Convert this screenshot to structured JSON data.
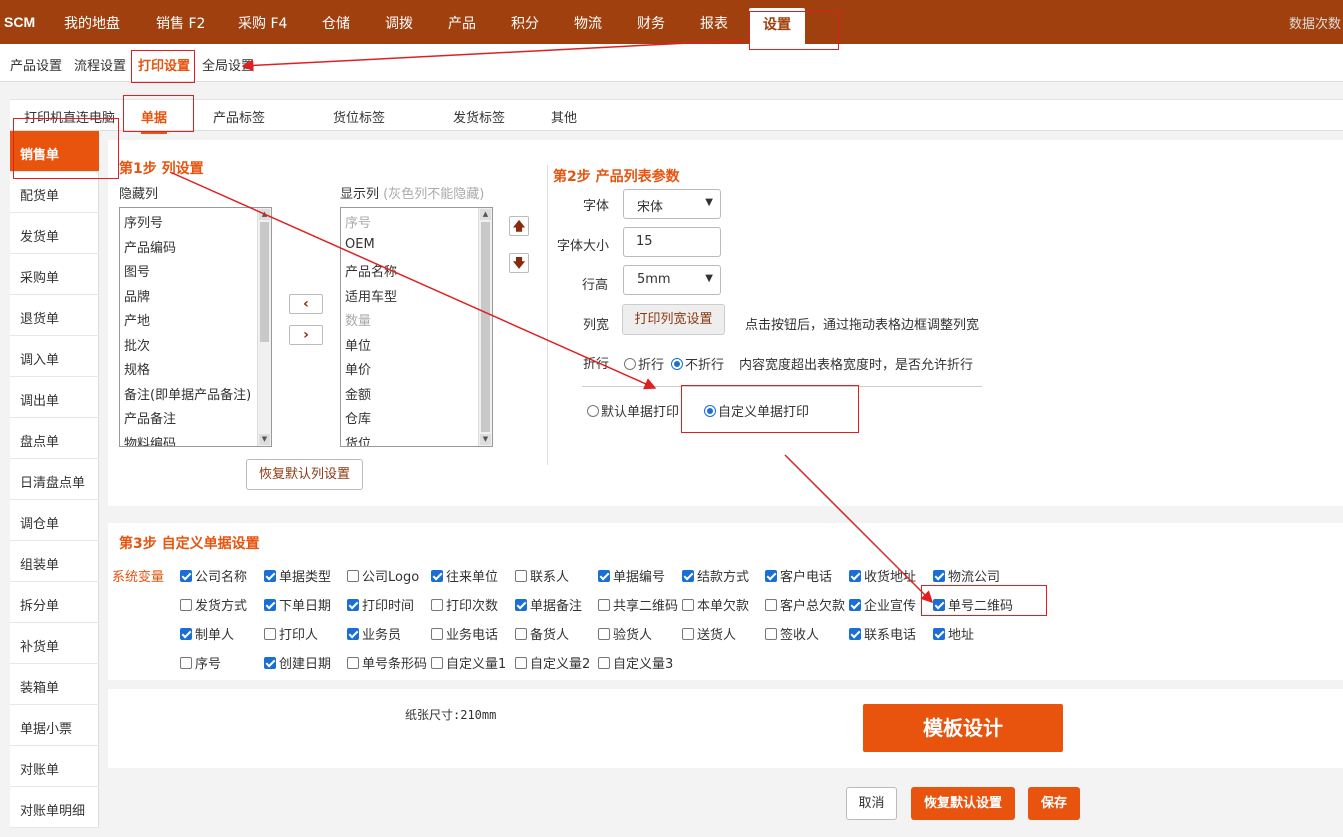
{
  "topbar": {
    "logo": "SCM",
    "nav": [
      "我的地盘",
      "销售 F2",
      "采购 F4",
      "仓储",
      "调拨",
      "产品",
      "积分",
      "物流",
      "财务",
      "报表",
      "设置"
    ],
    "right_text": "数据次数"
  },
  "subnav": [
    "产品设置",
    "流程设置",
    "打印设置",
    "全局设置"
  ],
  "tabs": [
    "打印机直连电脑",
    "单据",
    "产品标签",
    "货位标签",
    "发货标签",
    "其他"
  ],
  "sidebar": [
    "销售单",
    "配货单",
    "发货单",
    "采购单",
    "退货单",
    "调入单",
    "调出单",
    "盘点单",
    "日清盘点单",
    "调仓单",
    "组装单",
    "拆分单",
    "补货单",
    "装箱单",
    "单据小票",
    "对账单",
    "对账单明细"
  ],
  "step1": {
    "title": "第1步 列设置",
    "hidden_label": "隐藏列",
    "shown_label": "显示列",
    "shown_hint": "(灰色列不能隐藏)",
    "hidden_cols": [
      "序列号",
      "产品编码",
      "图号",
      "品牌",
      "产地",
      "批次",
      "规格",
      "备注(即单据产品备注)",
      "产品备注",
      "物料编码"
    ],
    "shown_cols": [
      "序号",
      "OEM",
      "产品名称",
      "适用车型",
      "数量",
      "单位",
      "单价",
      "金额",
      "仓库",
      "货位"
    ],
    "restore_btn": "恢复默认列设置"
  },
  "step2": {
    "title": "第2步 产品列表参数",
    "font_label": "字体",
    "font_value": "宋体",
    "fontsize_label": "字体大小",
    "fontsize_value": "15",
    "lineheight_label": "行高",
    "lineheight_value": "5mm",
    "colwidth_label": "列宽",
    "colwidth_btn": "打印列宽设置",
    "colwidth_hint": "点击按钮后，通过拖动表格边框调整列宽",
    "wrap_label": "折行",
    "wrap_yes": "折行",
    "wrap_no": "不折行",
    "wrap_hint": "内容宽度超出表格宽度时，是否允许折行",
    "print_default": "默认单据打印",
    "print_custom": "自定义单据打印"
  },
  "step3": {
    "title": "第3步 自定义单据设置",
    "sysvar_label": "系统变量",
    "rows": [
      [
        [
          "公司名称",
          true
        ],
        [
          "单据类型",
          true
        ],
        [
          "公司Logo",
          false
        ],
        [
          "往来单位",
          true
        ],
        [
          "联系人",
          false
        ],
        [
          "单据编号",
          true
        ],
        [
          "结款方式",
          true
        ],
        [
          "客户电话",
          true
        ],
        [
          "收货地址",
          true
        ],
        [
          "物流公司",
          true
        ]
      ],
      [
        [
          "发货方式",
          false
        ],
        [
          "下单日期",
          true
        ],
        [
          "打印时间",
          true
        ],
        [
          "打印次数",
          false
        ],
        [
          "单据备注",
          true
        ],
        [
          "共享二维码",
          false
        ],
        [
          "本单欠款",
          false
        ],
        [
          "客户总欠款",
          false
        ],
        [
          "企业宣传",
          true
        ],
        [
          "单号二维码",
          true
        ]
      ],
      [
        [
          "制单人",
          true
        ],
        [
          "打印人",
          false
        ],
        [
          "业务员",
          true
        ],
        [
          "业务电话",
          false
        ],
        [
          "备货人",
          false
        ],
        [
          "验货人",
          false
        ],
        [
          "送货人",
          false
        ],
        [
          "签收人",
          false
        ],
        [
          "联系电话",
          true
        ],
        [
          "地址",
          true
        ]
      ],
      [
        [
          "序号",
          false
        ],
        [
          "创建日期",
          true
        ],
        [
          "单号条形码",
          false
        ],
        [
          "自定义量1",
          false
        ],
        [
          "自定义量2",
          false
        ],
        [
          "自定义量3",
          false
        ]
      ]
    ]
  },
  "paper": {
    "label": "纸张尺寸:210mm"
  },
  "template_btn": "模板设计",
  "footer": {
    "cancel": "取消",
    "restore": "恢复默认设置",
    "save": "保存"
  },
  "colors": {
    "brand": "#a0400e",
    "accent": "#e8530e",
    "annotation": "#e02020"
  }
}
